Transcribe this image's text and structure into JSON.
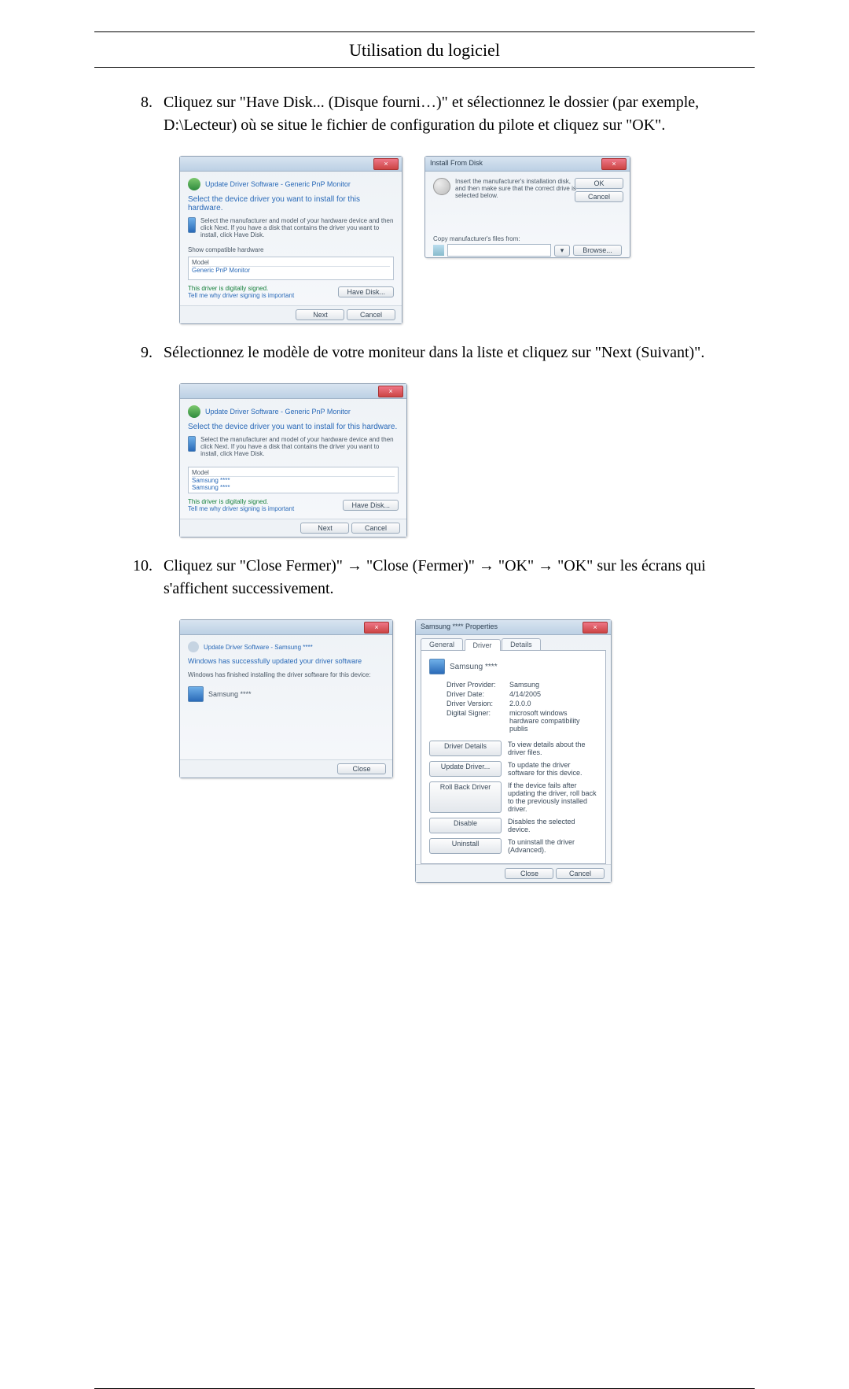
{
  "header": {
    "title": "Utilisation du logiciel"
  },
  "steps": {
    "s8": {
      "num": "8.",
      "text": "Cliquez sur \"Have Disk... (Disque fourni…)\" et sélectionnez le dossier (par exemple, D:\\Lecteur) où se situe le fichier de configuration du pilote et cliquez sur \"OK\"."
    },
    "s9": {
      "num": "9.",
      "text": "Sélectionnez le modèle de votre moniteur dans la liste et cliquez sur \"Next (Suivant)\"."
    },
    "s10": {
      "num": "10.",
      "text": "Cliquez sur \"Close Fermer)\" → \"Close (Fermer)\" → \"OK\" → \"OK\" sur les écrans qui s'affichent successivement."
    }
  },
  "win_update1": {
    "title": "Update Driver Software - Generic PnP Monitor",
    "heading": "Select the device driver you want to install for this hardware.",
    "desc": "Select the manufacturer and model of your hardware device and then click Next. If you have a disk that contains the driver you want to install, click Have Disk.",
    "check": "Show compatible hardware",
    "list_h": "Model",
    "list_item": "Generic PnP Monitor",
    "signed": "This driver is digitally signed.",
    "tell": "Tell me why driver signing is important",
    "havedisk": "Have Disk...",
    "next": "Next",
    "cancel": "Cancel",
    "close_x": "×"
  },
  "win_install": {
    "title": "Install From Disk",
    "desc": "Insert the manufacturer's installation disk, and then make sure that the correct drive is selected below.",
    "copy": "Copy manufacturer's files from:",
    "ok": "OK",
    "cancel": "Cancel",
    "browse": "Browse...",
    "drop": "▾",
    "close_x": "×"
  },
  "win_update2": {
    "title": "Update Driver Software - Generic PnP Monitor",
    "heading": "Select the device driver you want to install for this hardware.",
    "desc": "Select the manufacturer and model of your hardware device and then click Next. If you have a disk that contains the driver you want to install, click Have Disk.",
    "list_h": "Model",
    "m1": "Samsung ****",
    "m2": "Samsung ****",
    "signed": "This driver is digitally signed.",
    "tell": "Tell me why driver signing is important",
    "havedisk": "Have Disk...",
    "next": "Next",
    "cancel": "Cancel",
    "close_x": "×"
  },
  "win_done": {
    "title": "Update Driver Software - Samsung ****",
    "heading": "Windows has successfully updated your driver software",
    "desc": "Windows has finished installing the driver software for this device:",
    "device": "Samsung ****",
    "close": "Close",
    "close_x": "×"
  },
  "win_props": {
    "title": "Samsung **** Properties",
    "tab_general": "General",
    "tab_driver": "Driver",
    "tab_details": "Details",
    "device": "Samsung ****",
    "provider_k": "Driver Provider:",
    "provider_v": "Samsung",
    "date_k": "Driver Date:",
    "date_v": "4/14/2005",
    "version_k": "Driver Version:",
    "version_v": "2.0.0.0",
    "signer_k": "Digital Signer:",
    "signer_v": "microsoft windows hardware compatibility publis",
    "btn_details": "Driver Details",
    "txt_details": "To view details about the driver files.",
    "btn_update": "Update Driver...",
    "txt_update": "To update the driver software for this device.",
    "btn_roll": "Roll Back Driver",
    "txt_roll": "If the device fails after updating the driver, roll back to the previously installed driver.",
    "btn_disable": "Disable",
    "txt_disable": "Disables the selected device.",
    "btn_uninstall": "Uninstall",
    "txt_uninstall": "To uninstall the driver (Advanced).",
    "close": "Close",
    "cancel": "Cancel",
    "close_x": "×"
  }
}
